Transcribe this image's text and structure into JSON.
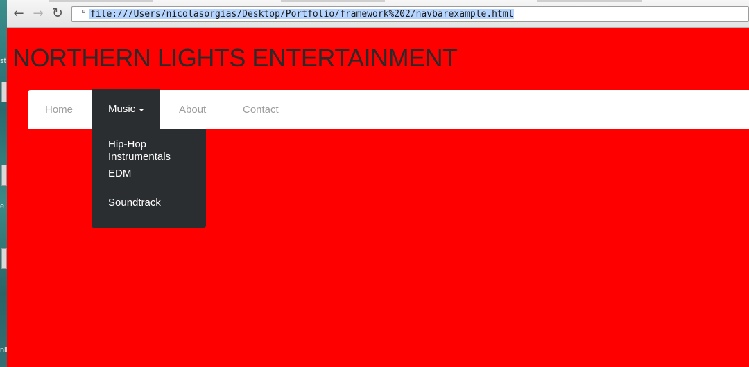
{
  "desktop": {
    "fragments": [
      "st",
      "e",
      "nli"
    ]
  },
  "browser": {
    "back_icon": "back-arrow-icon",
    "forward_icon": "forward-arrow-icon",
    "reload_icon": "reload-icon",
    "address_bar": {
      "url": "file:///Users/nicolasorgias/Desktop/Portfolio/framework%202/navbarexample.html"
    }
  },
  "page": {
    "background_color": "#ff0000",
    "site_title": "NORTHERN LIGHTS ENTERTAINMENT",
    "navbar": {
      "items": [
        {
          "label": "Home"
        },
        {
          "label": "Music",
          "active": true,
          "has_dropdown": true
        },
        {
          "label": "About"
        },
        {
          "label": "Contact"
        }
      ],
      "active_bg": "#2b2e31"
    },
    "dropdown": {
      "items": [
        {
          "label_line1": "Hip-Hop",
          "label_line2": "Instrumentals"
        },
        {
          "label": "EDM"
        },
        {
          "label": "Soundtrack"
        }
      ]
    }
  }
}
